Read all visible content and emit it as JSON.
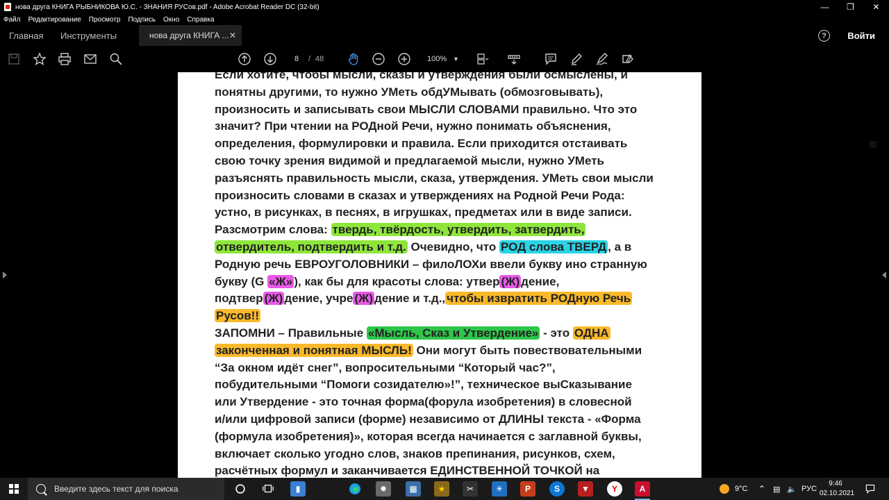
{
  "window": {
    "title": "нова друга КНИГА РЫБНИКОВА Ю.С. - ЗНАНИЯ РУСов.pdf - Adobe Acrobat Reader DC (32-bit)"
  },
  "menu": [
    "Файл",
    "Редактирование",
    "Просмотр",
    "Подпись",
    "Окно",
    "Справка"
  ],
  "tabs": {
    "home": "Главная",
    "tools": "Инструменты",
    "document": "нова друга КНИГА ..."
  },
  "signin_label": "Войти",
  "toolbar": {
    "current_page": "8",
    "page_separator": "/",
    "total_pages": "48",
    "zoom": "100%"
  },
  "document": {
    "lines": [
      [
        {
          "t": "Если хотите, чтобы мысли, сказы и утверждения были осмыслены, и"
        }
      ],
      [
        {
          "t": "понятны другими, то нужно УМеть обдУМывать (обмозговывать),"
        }
      ],
      [
        {
          "t": "произносить и записывать свои МЫСЛИ СЛОВАМИ правильно. Что это"
        }
      ],
      [
        {
          "t": "значит? При чтении на РОДной Речи, нужно понимать объяснения,"
        }
      ],
      [
        {
          "t": "определения, формулировки и правила. Если приходится отстаивать"
        }
      ],
      [
        {
          "t": "свою точку зрения видимой и предлагаемой мысли, нужно УМеть"
        }
      ],
      [
        {
          "t": "разъяснять правильность мысли, сказа, утверждения. УМеть свои мысли"
        }
      ],
      [
        {
          "t": "произносить словами в сказах и утверждениях на Родной Речи Рода:"
        }
      ],
      [
        {
          "t": "устно, в рисунках, в песнях, в игрушках, предметах или в виде записи."
        }
      ],
      [
        {
          "t": " Разсмотрим слова:  "
        },
        {
          "t": "твердь, твёрдость, утвердить, затвердить,",
          "h": "green"
        }
      ],
      [
        {
          "t": "отвердитель, подтвердить и т.д.",
          "h": "green"
        },
        {
          "t": " Очевидно, что "
        },
        {
          "t": "РОД слова ТВЕРД",
          "h": "cyan"
        },
        {
          "t": ", а  в"
        }
      ],
      [
        {
          "t": "Родную речь ЕВРОУГОЛОВНИКИ – филоЛОХи ввели букву ино странную"
        }
      ],
      [
        {
          "t": "букву (G "
        },
        {
          "t": "«Ж»",
          "h": "magenta"
        },
        {
          "t": "), как бы для красоты слова: утвер"
        },
        {
          "t": "(Ж)",
          "h": "magenta"
        },
        {
          "t": "дение,"
        }
      ],
      [
        {
          "t": "подтвер"
        },
        {
          "t": "(Ж)",
          "h": "magenta"
        },
        {
          "t": "дение, учре"
        },
        {
          "t": "(Ж)",
          "h": "magenta"
        },
        {
          "t": "дение и т.д.,"
        },
        {
          "t": "чтобы извратить РОДную Речь",
          "h": "orange"
        }
      ],
      [
        {
          "t": "Русов!!",
          "h": "orange"
        }
      ],
      [
        {
          "t": " ЗАПОМНИ – Правильные "
        },
        {
          "t": "«Мысль, Сказ и Утвердение»",
          "h": "dkgreen"
        },
        {
          "t": " - это "
        },
        {
          "t": "ОДНА",
          "h": "orange"
        }
      ],
      [
        {
          "t": "законченная и понятная МЫСЛЬ!",
          "h": "orange"
        },
        {
          "t": " Они могут быть повествовательными"
        }
      ],
      [
        {
          "t": "“За окном идёт снег”, вопросительными “Который час?”,"
        }
      ],
      [
        {
          "t": "побудительными “Помоги созидателю»!”, техническое выСказывание"
        }
      ],
      [
        {
          "t": "или Утвердение - это точная форма(форула изобретения) в словесной"
        }
      ],
      [
        {
          "t": "и/или цифровой записи (форме) независимо от ДЛИНЫ текста - «Форма"
        }
      ],
      [
        {
          "t": "(формула изобретения)», которая всегда начинается с заглавной буквы,"
        }
      ],
      [
        {
          "t": "включает сколько угодно слов, знаков препинания, рисунков, схем,"
        }
      ],
      [
        {
          "t": "расчётных формул и заканчивается ЕДИНСТВЕННОЙ ТОЧКОЙ на"
        }
      ]
    ]
  },
  "taskbar": {
    "search_placeholder": "Введите здесь текст для поиска",
    "weather": "9°C",
    "language": "РУС",
    "time": "9:46",
    "date": "02.10.2021"
  },
  "colors": {
    "highlight_green": "#8ee63b",
    "highlight_cyan": "#2ad3e6",
    "highlight_magenta": "#e859e8",
    "highlight_orange": "#f9b92a",
    "highlight_dark_green": "#2ec64a"
  }
}
